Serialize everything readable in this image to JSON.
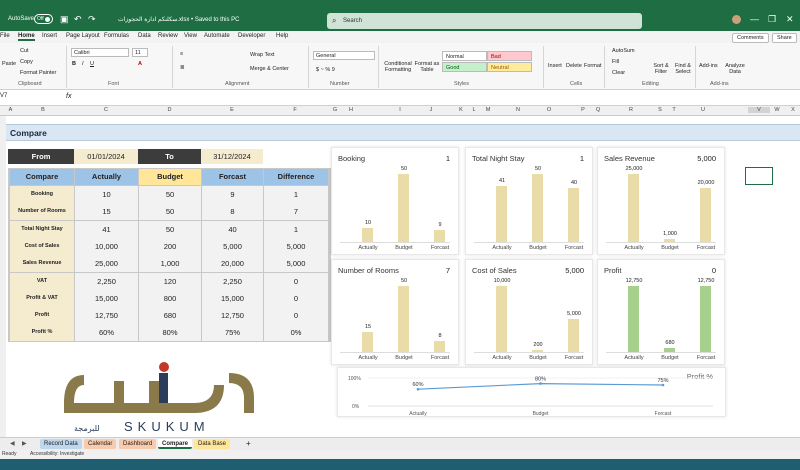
{
  "title_bar": {
    "autosave_label": "AutoSave",
    "autosave_state": "Off",
    "filename": "سكلنكم ادارة الحجوزات.xlsx • Saved to this PC",
    "search_placeholder": "Search"
  },
  "menu": [
    "File",
    "Home",
    "Insert",
    "Page Layout",
    "Formulas",
    "Data",
    "Review",
    "View",
    "Automate",
    "Developer",
    "Help"
  ],
  "top_buttons": {
    "comments": "Comments",
    "share": "Share"
  },
  "ribbon": {
    "cut": "Cut",
    "copy": "Copy",
    "format_painter": "Format Painter",
    "paste": "Paste",
    "clipboard": "Clipboard",
    "font_name": "Calibri",
    "font_size": "11",
    "font_group": "Font",
    "wrap_text": "Wrap Text",
    "merge_center": "Merge & Center",
    "alignment": "Alignment",
    "number_format": "General",
    "number_group": "Number",
    "conditional": "Conditional Formatting",
    "format_table": "Format as Table",
    "style_normal": "Normal",
    "style_bad": "Bad",
    "style_good": "Good",
    "style_neutral": "Neutral",
    "styles_group": "Styles",
    "insert": "Insert",
    "delete": "Delete",
    "format": "Format",
    "cells_group": "Cells",
    "autosum": "AutoSum",
    "fill": "Fill",
    "clear": "Clear",
    "sort_filter": "Sort & Filter",
    "find_select": "Find & Select",
    "editing_group": "Editing",
    "addins": "Add-ins",
    "analyze": "Analyze Data",
    "addins_group": "Add-ins"
  },
  "formula_bar": {
    "cell_ref": "V7",
    "fx": "fx",
    "content": ""
  },
  "columns": [
    "A",
    "B",
    "C",
    "D",
    "E",
    "F",
    "G",
    "H",
    "I",
    "J",
    "K",
    "L",
    "M",
    "N",
    "O",
    "P",
    "Q",
    "R",
    "S",
    "T",
    "U",
    "V",
    "W",
    "X"
  ],
  "banner_title": "Compare",
  "date_range": {
    "from_label": "From",
    "from_value": "01/01/2024",
    "to_label": "To",
    "to_value": "31/12/2024"
  },
  "table": {
    "headers": [
      "Compare",
      "Actually",
      "Budget",
      "Forcast",
      "Difference"
    ],
    "rows": [
      {
        "label": "Booking",
        "actual": "10",
        "budget": "50",
        "forcast": "9",
        "diff": "1"
      },
      {
        "label": "Number of Rooms",
        "actual": "15",
        "budget": "50",
        "forcast": "8",
        "diff": "7"
      },
      {
        "label": "Total Night Stay",
        "actual": "41",
        "budget": "50",
        "forcast": "40",
        "diff": "1"
      },
      {
        "label": "Cost of Sales",
        "actual": "10,000",
        "budget": "200",
        "forcast": "5,000",
        "diff": "5,000"
      },
      {
        "label": "Sales Revenue",
        "actual": "25,000",
        "budget": "1,000",
        "forcast": "20,000",
        "diff": "5,000"
      },
      {
        "label": "VAT",
        "actual": "2,250",
        "budget": "120",
        "forcast": "2,250",
        "diff": "0"
      },
      {
        "label": "Profit & VAT",
        "actual": "15,000",
        "budget": "800",
        "forcast": "15,000",
        "diff": "0"
      },
      {
        "label": "Profit",
        "actual": "12,750",
        "budget": "680",
        "forcast": "12,750",
        "diff": "0"
      },
      {
        "label": "Profit %",
        "actual": "60%",
        "budget": "80%",
        "forcast": "75%",
        "diff": "0%"
      }
    ]
  },
  "chart_data": [
    {
      "type": "bar",
      "title": "Booking",
      "value": "1",
      "categories": [
        "Actually",
        "Budget",
        "Forcast"
      ],
      "values": [
        10,
        50,
        9
      ],
      "labels": [
        "10",
        "50",
        "9"
      ],
      "ylim": [
        0,
        50
      ],
      "color": "#e9dca8"
    },
    {
      "type": "bar",
      "title": "Total Night Stay",
      "value": "1",
      "categories": [
        "Actually",
        "Budget",
        "Forcast"
      ],
      "values": [
        41,
        50,
        40
      ],
      "labels": [
        "41",
        "50",
        "40"
      ],
      "ylim": [
        0,
        50
      ],
      "color": "#e9dca8"
    },
    {
      "type": "bar",
      "title": "Sales Revenue",
      "value": "5,000",
      "categories": [
        "Actually",
        "Budget",
        "Forcast"
      ],
      "values": [
        25000,
        1000,
        20000
      ],
      "labels": [
        "25,000",
        "1,000",
        "20,000"
      ],
      "ylim": [
        0,
        25000
      ],
      "color": "#e9dca8"
    },
    {
      "type": "bar",
      "title": "Number of Rooms",
      "value": "7",
      "categories": [
        "Actually",
        "Budget",
        "Forcast"
      ],
      "values": [
        15,
        50,
        8
      ],
      "labels": [
        "15",
        "50",
        "8"
      ],
      "ylim": [
        0,
        50
      ],
      "color": "#e9dca8"
    },
    {
      "type": "bar",
      "title": "Cost of Sales",
      "value": "5,000",
      "categories": [
        "Actually",
        "Budget",
        "Forcast"
      ],
      "values": [
        10000,
        200,
        5000
      ],
      "labels": [
        "10,000",
        "200",
        "5,000"
      ],
      "ylim": [
        0,
        10000
      ],
      "color": "#e9dca8"
    },
    {
      "type": "bar",
      "title": "Profit",
      "value": "0",
      "categories": [
        "Actually",
        "Budget",
        "Forcast"
      ],
      "values": [
        12750,
        680,
        12750
      ],
      "labels": [
        "12,750",
        "680",
        "12,750"
      ],
      "ylim": [
        0,
        12750
      ],
      "color": "#a8d08d"
    },
    {
      "type": "line",
      "title": "Profit %",
      "categories": [
        "Actually",
        "Budget",
        "Forcast"
      ],
      "values": [
        60,
        80,
        75
      ],
      "labels": [
        "60%",
        "80%",
        "75%"
      ],
      "yticks": [
        "100%",
        "0%"
      ],
      "ylim": [
        0,
        100
      ],
      "color": "#5b9bd5"
    }
  ],
  "logo": {
    "arabic": "سكلنكم",
    "latin": "SKUKUM",
    "sub": "للبرمجة"
  },
  "sheet_tabs": [
    "Record Data",
    "Calendar",
    "Dashboard",
    "Compare",
    "Data Base"
  ],
  "status": {
    "ready": "Ready",
    "accessibility": "Accessibility: Investigate"
  },
  "colors": {
    "excel_green": "#1f6e43",
    "banner": "#d9e6f3",
    "tan": "#f5ecd0",
    "header_blue": "#9dc3e6",
    "budget_yellow": "#ffe699",
    "dark": "#3c3c3c",
    "bar_tan": "#e9dca8",
    "bar_green": "#a8d08d"
  }
}
